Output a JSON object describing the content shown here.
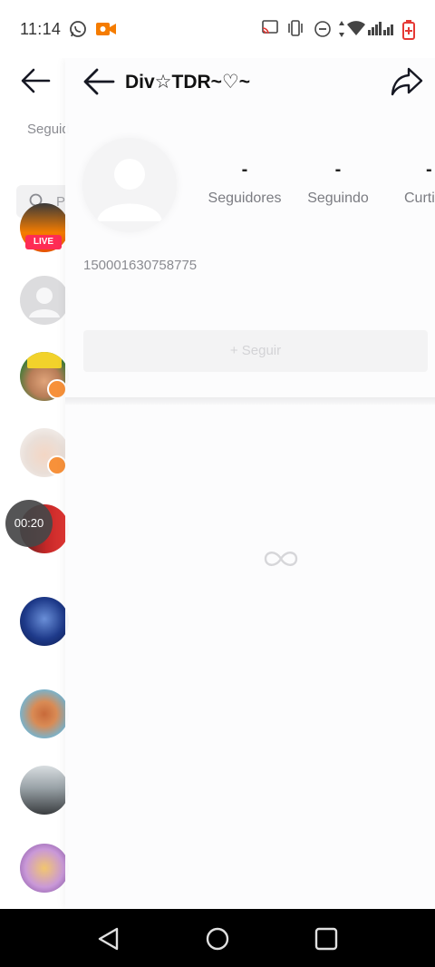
{
  "status_bar": {
    "time": "11:14",
    "icons": [
      "whatsapp-icon",
      "video-record-icon",
      "cast-icon",
      "vibrate-icon",
      "do-not-disturb-icon",
      "data-arrows-icon",
      "wifi-icon",
      "signal-icon",
      "battery-icon"
    ]
  },
  "background_list": {
    "tab_label": "Seguid",
    "search_placeholder": "P",
    "live_badge": "LIVE",
    "timer": "00:20"
  },
  "profile": {
    "title": "Div☆TDR~♡~",
    "stats": [
      {
        "value": "-",
        "label": "Seguidores"
      },
      {
        "value": "-",
        "label": "Seguindo"
      },
      {
        "value": "-",
        "label": "Curti"
      }
    ],
    "user_id": "150001630758775",
    "follow_label": "+ Seguir"
  },
  "colors": {
    "accent": "#fe2c55",
    "badge": "#f7913a",
    "nav_bar": "#000000"
  }
}
